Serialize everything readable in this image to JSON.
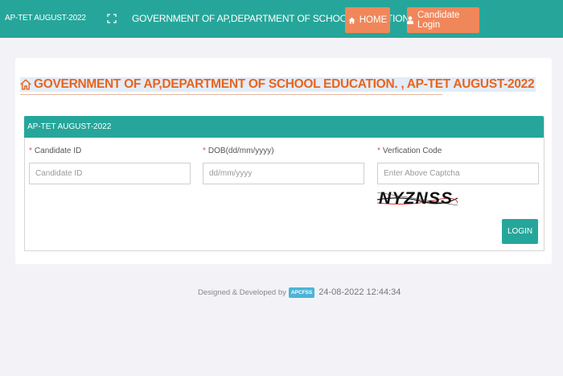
{
  "header": {
    "brand": "AP-TET AUGUST-2022",
    "title": "GOVERNMENT OF AP,DEPARTMENT OF SCHOOL EDUCATION.",
    "home_label": "HOME",
    "candidate_login_label": "Candidate Login"
  },
  "main": {
    "heading": "GOVERNMENT OF AP,DEPARTMENT OF SCHOOL EDUCATION. , AP-TET AUGUST-2022",
    "panel_title": "AP-TET AUGUST-2022",
    "fields": {
      "candidate_id": {
        "required_mark": "*",
        "label": "Candidate ID",
        "placeholder": "Candidate ID",
        "value": ""
      },
      "dob": {
        "required_mark": "*",
        "label": "DOB(dd/mm/yyyy)",
        "placeholder": "dd/mm/yyyy",
        "value": ""
      },
      "verification": {
        "required_mark": "*",
        "label": "Verfication Code",
        "placeholder": "Enter Above Captcha",
        "value": ""
      }
    },
    "captcha_text": "NYZNSS",
    "login_label": "LOGIN"
  },
  "footer": {
    "designed_by": "Designed & Developed by",
    "badge": "APCFSS",
    "timestamp": "24-08-2022 12:44:34"
  },
  "icons": {
    "expand": "expand-icon",
    "home": "home-icon",
    "user": "user-icon",
    "house_outline": "house-outline-icon"
  },
  "colors": {
    "primary": "#26a69a",
    "accent_button": "#f0875a",
    "heading": "#e8641e",
    "required": "#d9534f",
    "badge": "#4bb4d6"
  }
}
